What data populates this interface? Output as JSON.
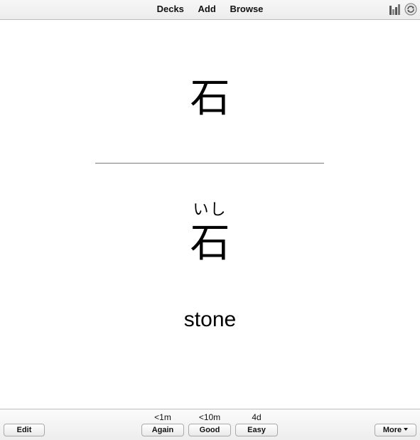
{
  "toolbar": {
    "nav": [
      "Decks",
      "Add",
      "Browse"
    ],
    "icons": [
      "stats-icon",
      "sync-icon"
    ]
  },
  "card": {
    "front": "石",
    "reading": "いし",
    "back": "石",
    "meaning": "stone"
  },
  "footer": {
    "edit_label": "Edit",
    "answers": [
      {
        "label": "Again",
        "interval": "<1m"
      },
      {
        "label": "Good",
        "interval": "<10m"
      },
      {
        "label": "Easy",
        "interval": "4d"
      }
    ],
    "more_label": "More"
  }
}
